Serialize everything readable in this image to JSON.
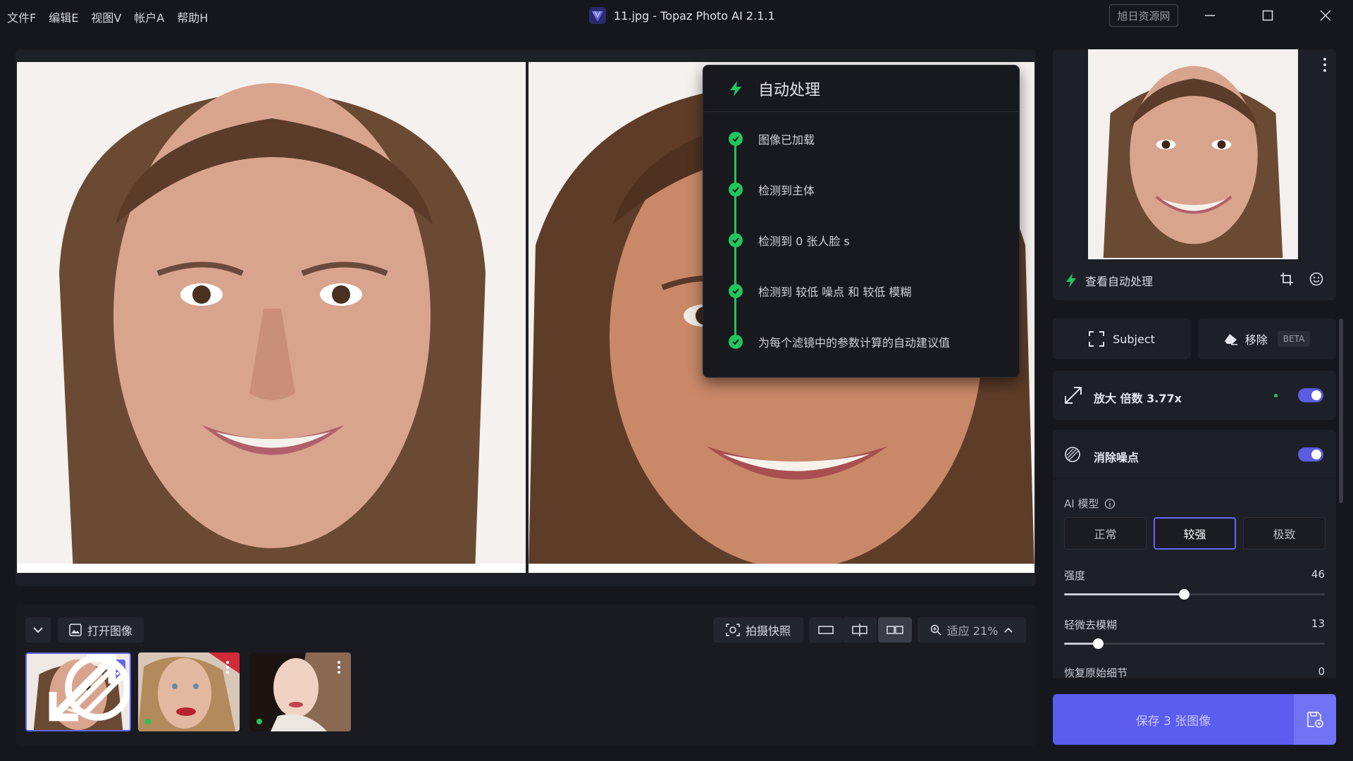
{
  "menu": [
    "文件F",
    "编辑E",
    "视图V",
    "帐户A",
    "帮助H"
  ],
  "window": {
    "title": "11.jpg - Topaz Photo AI 2.1.1",
    "watermark": "旭日资源网"
  },
  "auto_panel": {
    "title": "自动处理",
    "steps": [
      "图像已加载",
      "检测到主体",
      "检测到 0 张人脸 s",
      "检测到 较低  噪点 和 较低  模糊",
      "为每个滤镜中的参数计算的自动建议值"
    ]
  },
  "bottom_bar": {
    "open_image": "打开图像",
    "snapshot": "拍摄快照",
    "zoom": "适应 21%"
  },
  "sidebar": {
    "view_auto": "查看自动处理",
    "subject_label": "Subject",
    "remove_label": "移除",
    "beta_badge": "BETA",
    "upscale_label": "放大 倍数 3.77x",
    "denoise_label": "消除噪点",
    "ai_model_label": "AI 模型",
    "models": [
      "正常",
      "较强",
      "极致"
    ],
    "selected_model": "较强",
    "sliders": [
      {
        "label": "强度",
        "value": "46",
        "fraction": 0.46
      },
      {
        "label": "轻微去模糊",
        "value": "13",
        "fraction": 0.13
      },
      {
        "label": "恢复原始细节",
        "value": "0",
        "fraction": 0.0
      }
    ],
    "save_label": "保存 3 张图像"
  },
  "colors": {
    "accent": "#5b5cf0",
    "success": "#22c55e",
    "bg": "#16171c"
  }
}
